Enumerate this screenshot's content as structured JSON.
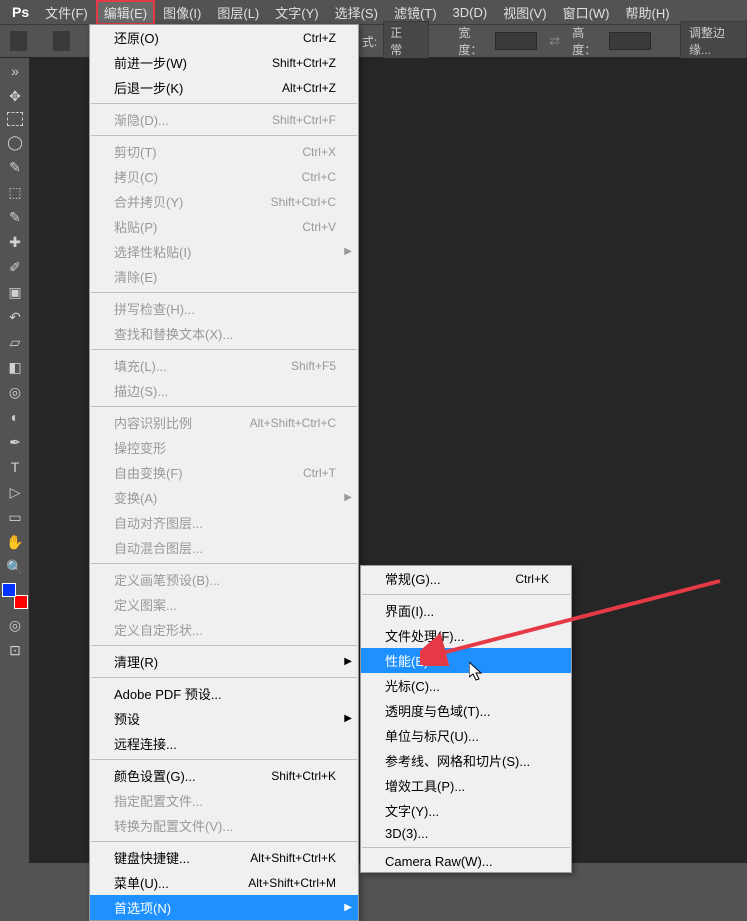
{
  "app": {
    "logo": "Ps"
  },
  "menubar": [
    {
      "label": "文件(F)"
    },
    {
      "label": "编辑(E)",
      "highlight": true
    },
    {
      "label": "图像(I)"
    },
    {
      "label": "图层(L)"
    },
    {
      "label": "文字(Y)"
    },
    {
      "label": "选择(S)"
    },
    {
      "label": "滤镜(T)"
    },
    {
      "label": "3D(D)"
    },
    {
      "label": "视图(V)"
    },
    {
      "label": "窗口(W)"
    },
    {
      "label": "帮助(H)"
    }
  ],
  "options": {
    "mode_lbl": "式:",
    "mode_val": "正常",
    "width_lbl": "宽度：",
    "height_lbl": "高度：",
    "adjust_btn": "调整边缘..."
  },
  "edit_menu": [
    {
      "label": "还原(O)",
      "shortcut": "Ctrl+Z"
    },
    {
      "label": "前进一步(W)",
      "shortcut": "Shift+Ctrl+Z"
    },
    {
      "label": "后退一步(K)",
      "shortcut": "Alt+Ctrl+Z"
    },
    {
      "sep": true
    },
    {
      "label": "渐隐(D)...",
      "shortcut": "Shift+Ctrl+F",
      "disabled": true
    },
    {
      "sep": true
    },
    {
      "label": "剪切(T)",
      "shortcut": "Ctrl+X",
      "disabled": true
    },
    {
      "label": "拷贝(C)",
      "shortcut": "Ctrl+C",
      "disabled": true
    },
    {
      "label": "合并拷贝(Y)",
      "shortcut": "Shift+Ctrl+C",
      "disabled": true
    },
    {
      "label": "粘贴(P)",
      "shortcut": "Ctrl+V",
      "disabled": true
    },
    {
      "label": "选择性粘贴(I)",
      "disabled": true,
      "arrow": true
    },
    {
      "label": "清除(E)",
      "disabled": true
    },
    {
      "sep": true
    },
    {
      "label": "拼写检查(H)...",
      "disabled": true
    },
    {
      "label": "查找和替换文本(X)...",
      "disabled": true
    },
    {
      "sep": true
    },
    {
      "label": "填充(L)...",
      "shortcut": "Shift+F5",
      "disabled": true
    },
    {
      "label": "描边(S)...",
      "disabled": true
    },
    {
      "sep": true
    },
    {
      "label": "内容识别比例",
      "shortcut": "Alt+Shift+Ctrl+C",
      "disabled": true
    },
    {
      "label": "操控变形",
      "disabled": true
    },
    {
      "label": "自由变换(F)",
      "shortcut": "Ctrl+T",
      "disabled": true
    },
    {
      "label": "变换(A)",
      "disabled": true,
      "arrow": true
    },
    {
      "label": "自动对齐图层...",
      "disabled": true
    },
    {
      "label": "自动混合图层...",
      "disabled": true
    },
    {
      "sep": true
    },
    {
      "label": "定义画笔预设(B)...",
      "disabled": true
    },
    {
      "label": "定义图案...",
      "disabled": true
    },
    {
      "label": "定义自定形状...",
      "disabled": true
    },
    {
      "sep": true
    },
    {
      "label": "清理(R)",
      "arrow": true
    },
    {
      "sep": true
    },
    {
      "label": "Adobe PDF 预设..."
    },
    {
      "label": "预设",
      "arrow": true
    },
    {
      "label": "远程连接..."
    },
    {
      "sep": true
    },
    {
      "label": "颜色设置(G)...",
      "shortcut": "Shift+Ctrl+K"
    },
    {
      "label": "指定配置文件...",
      "disabled": true
    },
    {
      "label": "转换为配置文件(V)...",
      "disabled": true
    },
    {
      "sep": true
    },
    {
      "label": "键盘快捷键...",
      "shortcut": "Alt+Shift+Ctrl+K"
    },
    {
      "label": "菜单(U)...",
      "shortcut": "Alt+Shift+Ctrl+M"
    },
    {
      "label": "首选项(N)",
      "arrow": true,
      "hl": true
    }
  ],
  "prefs_submenu": [
    {
      "label": "常规(G)...",
      "shortcut": "Ctrl+K"
    },
    {
      "sep": true
    },
    {
      "label": "界面(I)..."
    },
    {
      "label": "文件处理(F)..."
    },
    {
      "label": "性能(E)...",
      "hl": true
    },
    {
      "label": "光标(C)..."
    },
    {
      "label": "透明度与色域(T)..."
    },
    {
      "label": "单位与标尺(U)..."
    },
    {
      "label": "参考线、网格和切片(S)..."
    },
    {
      "label": "增效工具(P)..."
    },
    {
      "label": "文字(Y)..."
    },
    {
      "label": "3D(3)..."
    },
    {
      "sep": true
    },
    {
      "label": "Camera Raw(W)..."
    }
  ]
}
